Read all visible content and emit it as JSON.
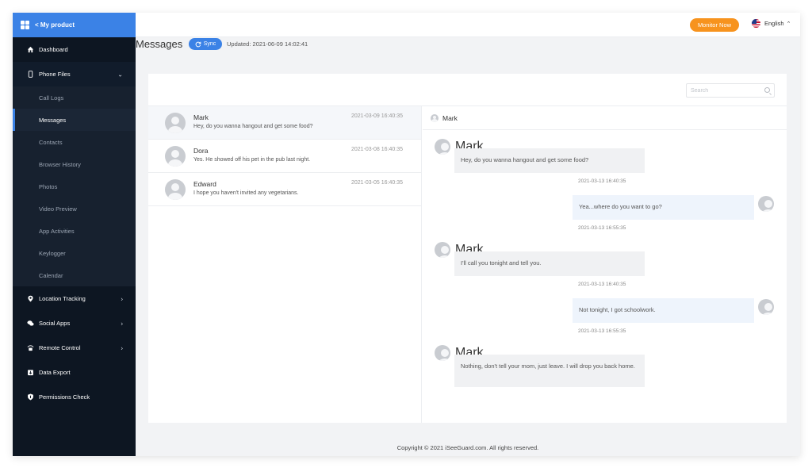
{
  "brand": {
    "label": "< My product"
  },
  "sidebar": {
    "items": [
      {
        "label": "Dashboard",
        "icon": "home-icon"
      },
      {
        "label": "Phone Files",
        "icon": "phone-icon",
        "expanded": true,
        "children": [
          "Call Logs",
          "Messages",
          "Contacts",
          "Browser History",
          "Photos",
          "Video Preview",
          "App Activities",
          "Keylogger",
          "Calendar"
        ],
        "active_child": "Messages"
      },
      {
        "label": "Location Tracking",
        "icon": "location-pin-icon"
      },
      {
        "label": "Social Apps",
        "icon": "chat-bubbles-icon"
      },
      {
        "label": "Remote Control",
        "icon": "remote-control-icon"
      },
      {
        "label": "Data Export",
        "icon": "export-icon"
      },
      {
        "label": "Permissions Check",
        "icon": "shield-icon"
      }
    ]
  },
  "topbar": {
    "monitor_label": "Monitor Now",
    "language": "English"
  },
  "header": {
    "title": "Messages",
    "sync_label": "Sync",
    "updated": "Updated: 2021-06-09 14:02:41"
  },
  "search": {
    "placeholder": "Search"
  },
  "conversations": [
    {
      "name": "Mark",
      "preview": "Hey, do you wanna hangout and get some food?",
      "time": "2021-03-09 16:40:35"
    },
    {
      "name": "Dora",
      "preview": "Yes. He showed off his pet in the pub last night.",
      "time": "2021-03-08 16:40:35"
    },
    {
      "name": "Edward",
      "preview": "I hope you haven't invited any vegetarians.",
      "time": "2021-03-05 16:40:35"
    }
  ],
  "chat": {
    "contact": "Mark",
    "messages": [
      {
        "direction": "in",
        "sender": "Mark",
        "text": "Hey, do you wanna hangout and get some food?",
        "time": "2021-03-13 16:40:35"
      },
      {
        "direction": "out",
        "text": "Yea...where do you want to go?",
        "time": "2021-03-13 16:55:35"
      },
      {
        "direction": "in",
        "sender": "Mark",
        "text": "I'll call you tonight and tell you.",
        "time": "2021-03-13 16:40:35"
      },
      {
        "direction": "out",
        "text": "Not tonight, I got schoolwork.",
        "time": "2021-03-13 16:55:35"
      },
      {
        "direction": "in",
        "sender": "Mark",
        "text": "Nothing, don't tell your mom, just leave. I will drop you back home.",
        "time": ""
      }
    ]
  },
  "footer": {
    "copyright": "Copyright © 2021 iSeeGuard.com. All rights reserved."
  },
  "colors": {
    "accent": "#3b82e6",
    "sidebar": "#111c2b",
    "monitor_button": "#f7931e"
  }
}
